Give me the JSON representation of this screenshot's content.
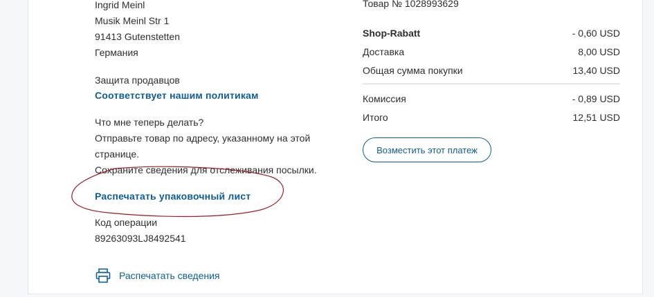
{
  "address": {
    "name": "Ingrid Meinl",
    "street": "Musik Meinl Str 1",
    "city": "91413 Gutenstetten",
    "country": "Германия"
  },
  "seller_protection": {
    "label": "Защита продавцов",
    "status_link": "Соответствует нашим политикам"
  },
  "next_steps": {
    "question": "Что мне теперь делать?",
    "line1": "Отправьте товар по адресу, указанному на этой",
    "line2": "странице.",
    "line3": "Сохраните сведения для отслеживания посылки.",
    "print_packing_slip": "Распечатать упаковочный лист"
  },
  "operation": {
    "label": "Код операции",
    "code": "89263093LJ8492541"
  },
  "print_details": "Распечатать сведения",
  "summary": {
    "item_number": "Товар № 1028993629",
    "rows": [
      {
        "label": "Shop-Rabatt",
        "value": "- 0,60 USD"
      },
      {
        "label": "Доставка",
        "value": "8,00 USD"
      },
      {
        "label": "Общая сумма покупки",
        "value": "13,40 USD"
      },
      {
        "label": "Комиссия",
        "value": "- 0,89 USD"
      },
      {
        "label": "Итого",
        "value": "12,51 USD"
      }
    ],
    "refund_button": "Возместить этот платеж"
  },
  "colors": {
    "link": "#0c5d97",
    "annotation": "#9b1c24"
  }
}
